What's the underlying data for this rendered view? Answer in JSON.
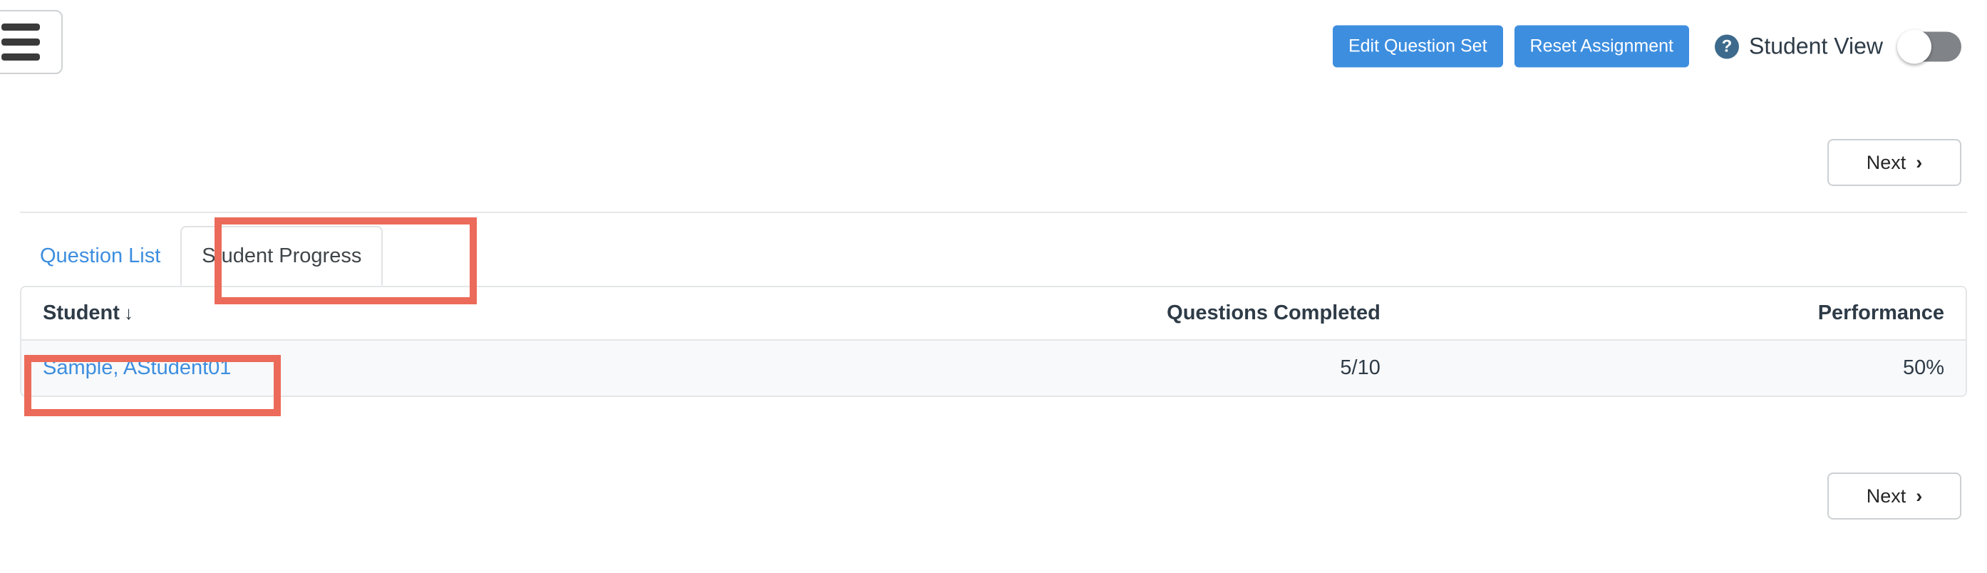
{
  "nav": {
    "menu_icon": "hamburger-menu-icon"
  },
  "toolbar": {
    "edit_question_set_label": "Edit Question Set",
    "reset_assignment_label": "Reset Assignment",
    "help_icon": "question-mark-help-icon",
    "student_view_label": "Student View",
    "student_view_toggle_state": "off"
  },
  "pagination": {
    "next_label": "Next",
    "next_chevron": "›"
  },
  "tabs": [
    {
      "label": "Question List",
      "active": false
    },
    {
      "label": "Student Progress",
      "active": true
    }
  ],
  "table": {
    "columns": [
      {
        "label": "Student",
        "sort_indicator": "↓",
        "align": "left"
      },
      {
        "label": "Questions Completed",
        "align": "right"
      },
      {
        "label": "Performance",
        "align": "right"
      }
    ],
    "rows": [
      {
        "student": "Sample, AStudent01",
        "questions_completed": "5/10",
        "performance": "50%"
      }
    ]
  },
  "annotations": {
    "highlight_color": "#ec6a59",
    "boxes": [
      {
        "target": "student-progress-tab"
      },
      {
        "target": "student-name-link"
      }
    ]
  },
  "colors": {
    "primary_button": "#3d8edf",
    "link": "#3d8edf",
    "help_icon": "#3d6a8c",
    "toggle_off_track": "#808488",
    "row_background": "#f8f9fa",
    "border": "#e4e6e8"
  }
}
